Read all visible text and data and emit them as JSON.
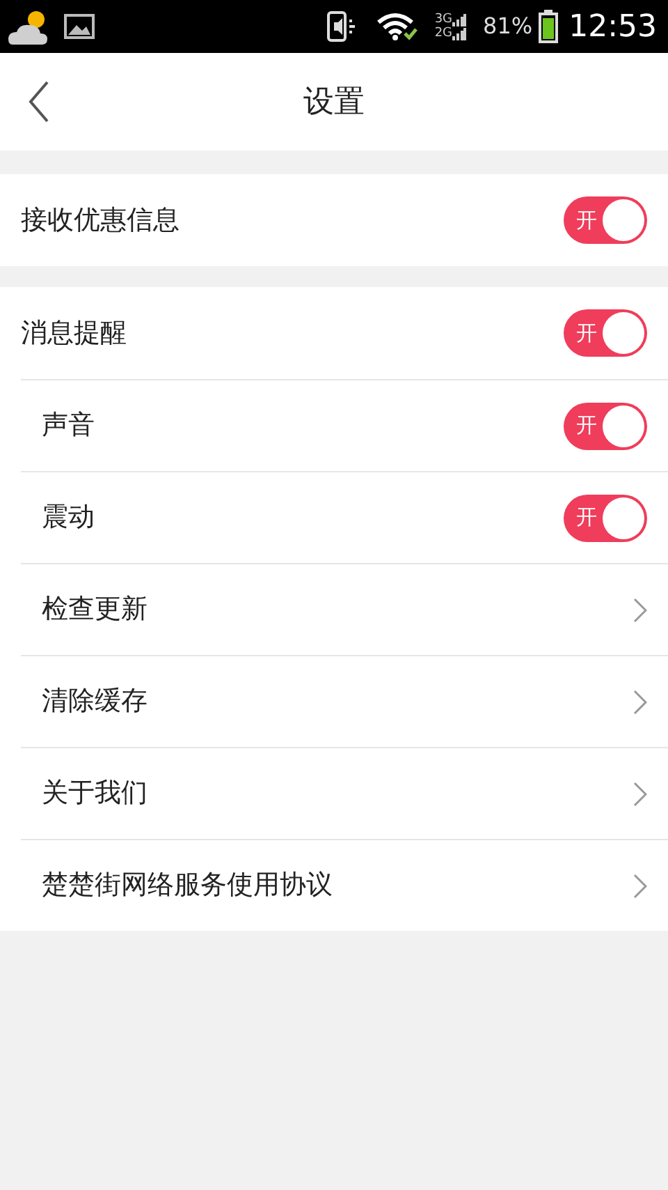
{
  "status_bar": {
    "network_top": "3G",
    "network_bottom": "2G",
    "battery": "81%",
    "time": "12:53"
  },
  "header": {
    "title": "设置"
  },
  "sections": [
    {
      "rows": [
        {
          "kind": "toggle",
          "label": "接收优惠信息",
          "on": true,
          "switch_text": "开"
        }
      ]
    },
    {
      "rows": [
        {
          "kind": "toggle",
          "label": "消息提醒",
          "on": true,
          "switch_text": "开"
        },
        {
          "kind": "toggle",
          "label": "声音",
          "on": true,
          "switch_text": "开"
        },
        {
          "kind": "toggle",
          "label": "震动",
          "on": true,
          "switch_text": "开"
        },
        {
          "kind": "link",
          "label": "检查更新"
        },
        {
          "kind": "link",
          "label": "清除缓存"
        },
        {
          "kind": "link",
          "label": "关于我们"
        },
        {
          "kind": "link",
          "label": "楚楚街网络服务使用协议"
        }
      ]
    }
  ]
}
